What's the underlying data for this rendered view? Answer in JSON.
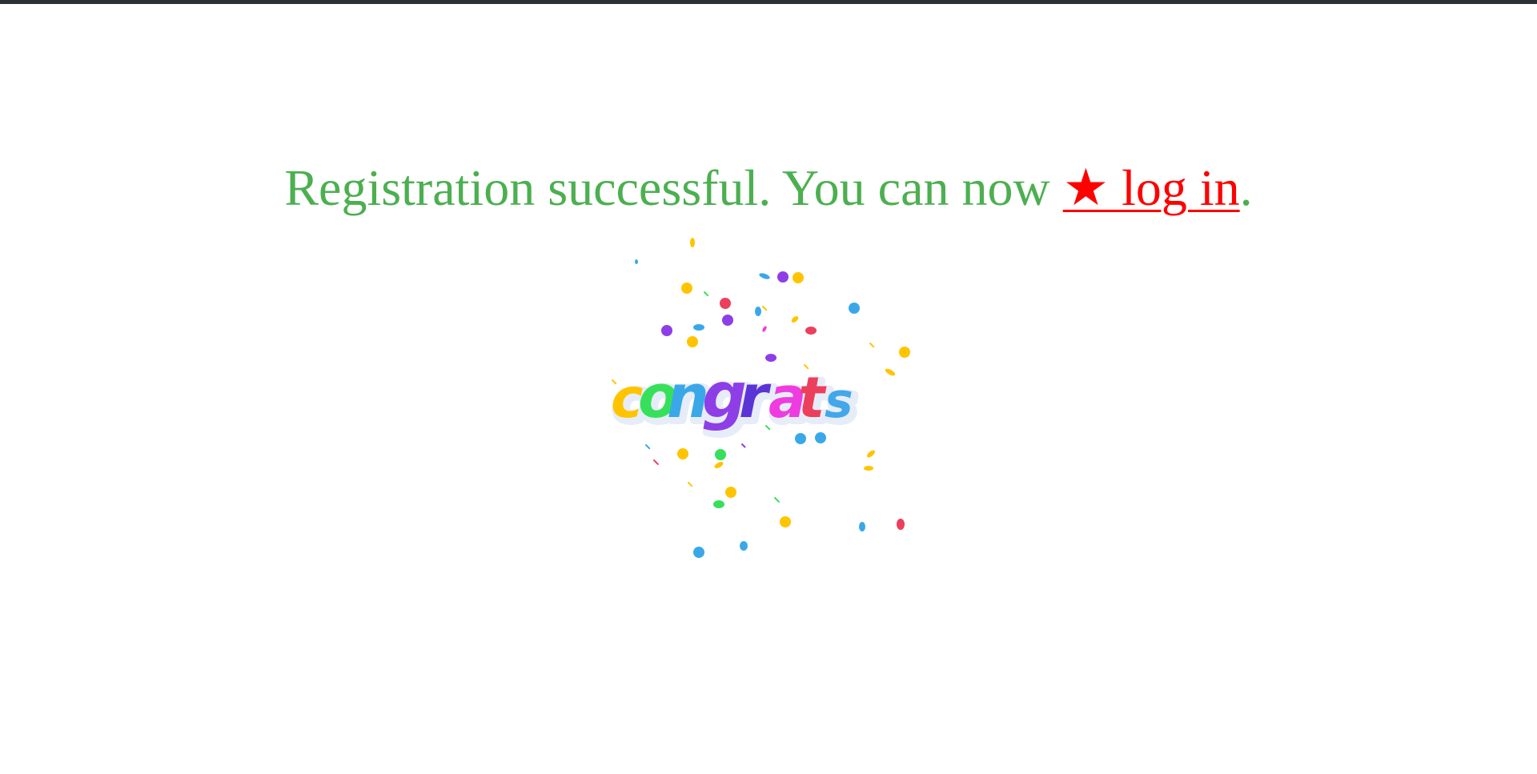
{
  "message": {
    "text_before": "Registration successful. You can now ",
    "link_label": "★ log in",
    "text_after": "."
  },
  "congrats_image": {
    "letters": [
      "c",
      "o",
      "n",
      "g",
      "r",
      "a",
      "t",
      "s"
    ],
    "letter_colors": [
      "#ffc400",
      "#37e05a",
      "#3aa8e8",
      "#8e3ee6",
      "#5b34d6",
      "#ef3ce0",
      "#ec3f5c",
      "#43a7ea"
    ],
    "confetti_colors": [
      "#ffc400",
      "#3aa8e8",
      "#8e3ee6",
      "#ec3f5c",
      "#37e05a",
      "#ef3ce0"
    ]
  },
  "colors": {
    "message_text": "#4caf50",
    "link": "#ff0000",
    "top_bar": "#2b2f36",
    "background": "#ffffff"
  }
}
